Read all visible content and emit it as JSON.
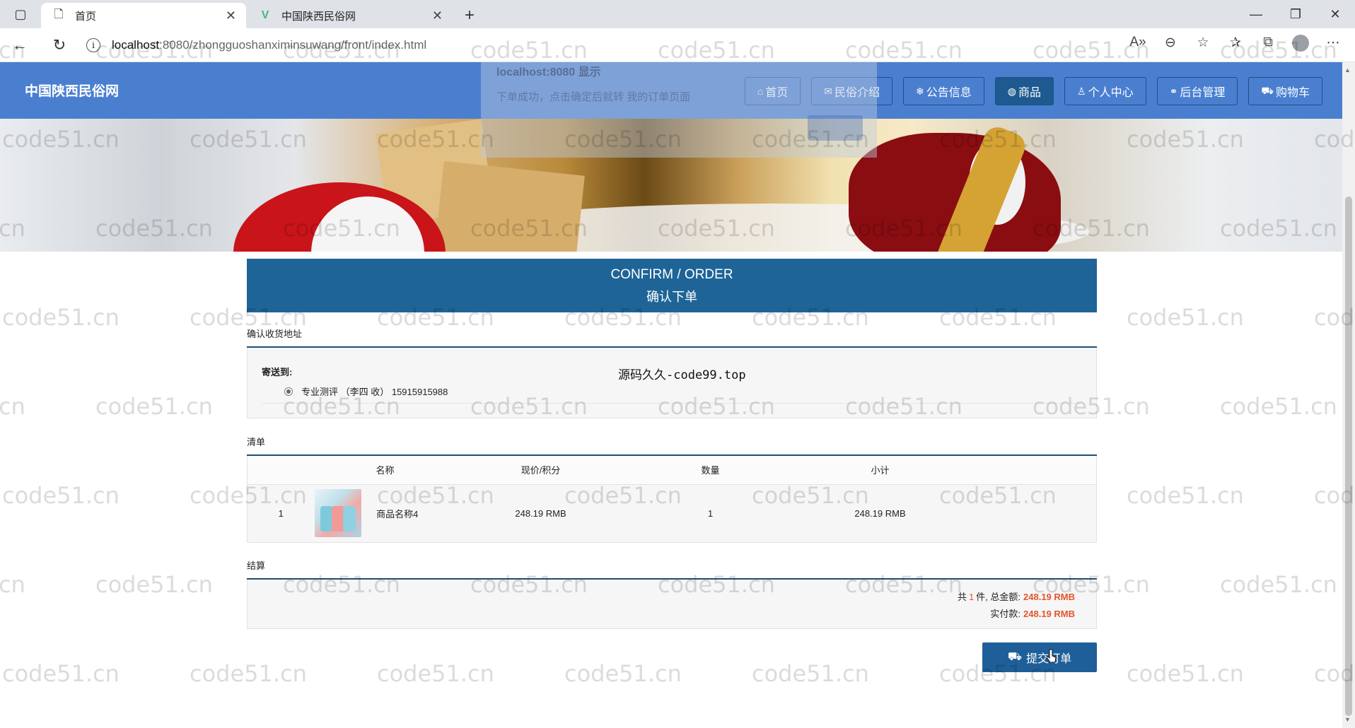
{
  "browser": {
    "tabs": [
      {
        "title": "首页",
        "icon": "page-icon",
        "active": true
      },
      {
        "title": "中国陕西民俗网",
        "icon": "vue-icon",
        "active": false
      }
    ],
    "url_host": "localhost",
    "url_path": ":8080/zhongguoshanximinsuwang/front/index.html"
  },
  "alert": {
    "title": "localhost:8080 显示",
    "message": "下单成功，点击确定后就转 我的订单页面"
  },
  "site": {
    "title": "中国陕西民俗网",
    "nav": [
      {
        "label": "首页",
        "icon": "home-icon",
        "glyph": "⌂"
      },
      {
        "label": "民俗介绍",
        "icon": "message-icon",
        "glyph": "✉"
      },
      {
        "label": "公告信息",
        "icon": "notice-icon",
        "glyph": "❄"
      },
      {
        "label": "商品",
        "icon": "globe-icon",
        "glyph": "◍",
        "active": true
      },
      {
        "label": "个人中心",
        "icon": "user-icon",
        "glyph": "♙"
      },
      {
        "label": "后台管理",
        "icon": "link-icon",
        "glyph": "⚭"
      },
      {
        "label": "购物车",
        "icon": "cart-icon",
        "glyph": "⛟"
      }
    ]
  },
  "confirm": {
    "title_en": "CONFIRM / ORDER",
    "title_cn": "确认下单"
  },
  "address": {
    "section_label": "确认收货地址",
    "ship_to_label": "寄送到:",
    "option": "专业测评 （李四 收） 15915915988",
    "center_text": "源码久久-code99.top"
  },
  "list": {
    "section_label": "清单",
    "headers": [
      "",
      "名称",
      "现价/积分",
      "数量",
      "小计"
    ],
    "rows": [
      {
        "index": "1",
        "name": "商品名称4",
        "price": "248.19 RMB",
        "qty": "1",
        "subtotal": "248.19 RMB"
      }
    ]
  },
  "settle": {
    "section_label": "结算",
    "count_prefix": "共",
    "count": "1",
    "count_suffix": "件, 总金额:",
    "total": "248.19 RMB",
    "paid_label": "实付款:",
    "paid": "248.19 RMB"
  },
  "submit": {
    "label": "提交订单",
    "icon": "cart-icon"
  },
  "watermark": "code51.cn",
  "colors": {
    "header": "#4a7fd0",
    "confirm": "#1f6497",
    "accent": "#e4552a",
    "button": "#1f5f99"
  }
}
